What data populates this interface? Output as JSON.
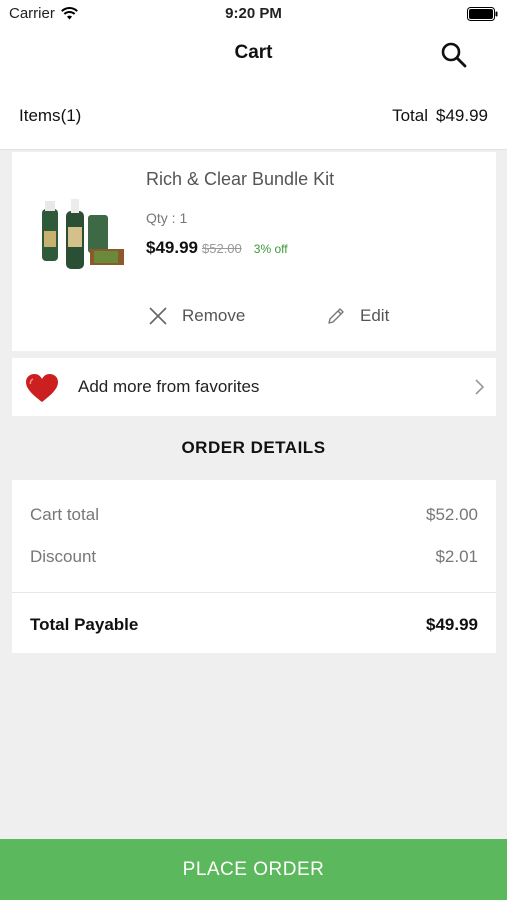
{
  "status_bar": {
    "carrier": "Carrier",
    "time": "9:20 PM"
  },
  "nav": {
    "title": "Cart"
  },
  "summary": {
    "items_label": "Items",
    "items_count": "(1)",
    "total_label": "Total",
    "total_value": "$49.99"
  },
  "product": {
    "name": "Rich & Clear Bundle Kit",
    "qty": "Qty : 1",
    "price": "$49.99",
    "mrp": "$52.00",
    "discount": "3% off",
    "remove_label": "Remove",
    "edit_label": "Edit"
  },
  "favorites": {
    "label": "Add more from favorites"
  },
  "order_details": {
    "title": "ORDER DETAILS",
    "cart_total_label": "Cart total",
    "cart_total_value": "$52.00",
    "discount_label": "Discount",
    "discount_value": "$2.01",
    "payable_label": "Total Payable",
    "payable_value": "$49.99"
  },
  "footer": {
    "place_order": "PLACE ORDER"
  },
  "colors": {
    "accent_green": "#5cb85c",
    "discount_green": "#3a9a3a",
    "heart_red": "#cc1f1f"
  }
}
